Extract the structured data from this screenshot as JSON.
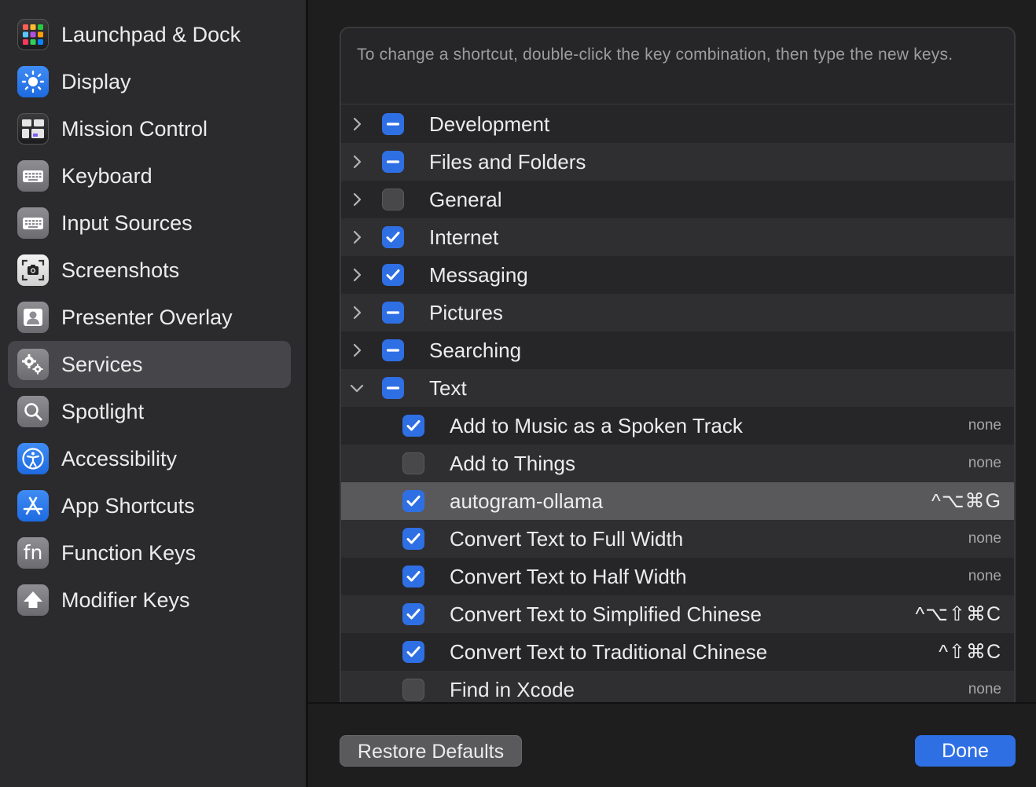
{
  "sidebar": {
    "items": [
      {
        "label": "Launchpad & Dock",
        "icon": "launchpad-icon"
      },
      {
        "label": "Display",
        "icon": "sun-icon"
      },
      {
        "label": "Mission Control",
        "icon": "mission-control-icon"
      },
      {
        "label": "Keyboard",
        "icon": "keyboard-icon"
      },
      {
        "label": "Input Sources",
        "icon": "keyboard-icon"
      },
      {
        "label": "Screenshots",
        "icon": "camera-icon"
      },
      {
        "label": "Presenter Overlay",
        "icon": "person-icon"
      },
      {
        "label": "Services",
        "icon": "gears-icon",
        "selected": true
      },
      {
        "label": "Spotlight",
        "icon": "magnifier-icon"
      },
      {
        "label": "Accessibility",
        "icon": "accessibility-icon"
      },
      {
        "label": "App Shortcuts",
        "icon": "app-store-icon"
      },
      {
        "label": "Function Keys",
        "icon": "fn-icon",
        "glyph": "fn"
      },
      {
        "label": "Modifier Keys",
        "icon": "up-arrow-icon"
      }
    ]
  },
  "main": {
    "hint": "To change a shortcut, double-click the key combination, then type the new keys.",
    "categories": [
      {
        "label": "Development",
        "state": "mixed",
        "expanded": false
      },
      {
        "label": "Files and Folders",
        "state": "mixed",
        "expanded": false
      },
      {
        "label": "General",
        "state": "off",
        "expanded": false
      },
      {
        "label": "Internet",
        "state": "on",
        "expanded": false
      },
      {
        "label": "Messaging",
        "state": "on",
        "expanded": false
      },
      {
        "label": "Pictures",
        "state": "mixed",
        "expanded": false
      },
      {
        "label": "Searching",
        "state": "mixed",
        "expanded": false
      },
      {
        "label": "Text",
        "state": "mixed",
        "expanded": true
      }
    ],
    "services": [
      {
        "label": "Add to Music as a Spoken Track",
        "state": "on",
        "shortcut": "none"
      },
      {
        "label": "Add to Things",
        "state": "off",
        "shortcut": "none"
      },
      {
        "label": "autogram-ollama",
        "state": "on",
        "shortcut": "^⌥⌘G",
        "highlighted": true
      },
      {
        "label": "Convert Text to Full Width",
        "state": "on",
        "shortcut": "none"
      },
      {
        "label": "Convert Text to Half Width",
        "state": "on",
        "shortcut": "none"
      },
      {
        "label": "Convert Text to Simplified Chinese",
        "state": "on",
        "shortcut": "^⌥⇧⌘C"
      },
      {
        "label": "Convert Text to Traditional Chinese",
        "state": "on",
        "shortcut": "^⇧⌘C"
      },
      {
        "label": "Find in Xcode",
        "state": "off",
        "shortcut": "none"
      }
    ]
  },
  "footer": {
    "restore_label": "Restore Defaults",
    "done_label": "Done"
  },
  "colors": {
    "accent": "#2f6fe4",
    "sidebar_bg": "#2b2b2d",
    "selected_bg": "#46464a",
    "main_bg": "#1e1e1e"
  }
}
